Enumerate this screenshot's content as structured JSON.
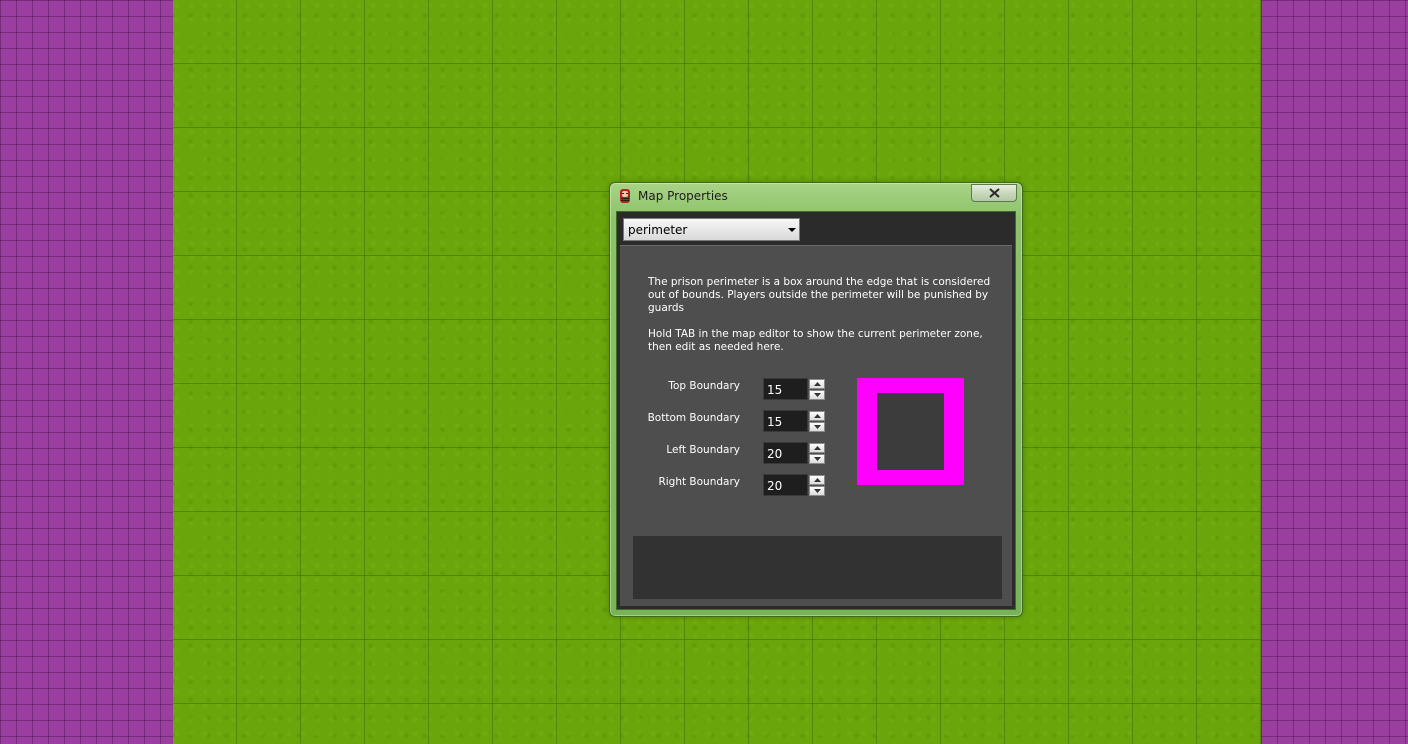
{
  "window": {
    "title": "Map Properties",
    "close_label": "✕"
  },
  "dropdown": {
    "selected": "perimeter"
  },
  "description": {
    "paragraph1": "The prison perimeter is a box around the edge that is considered out of bounds. Players outside the perimeter will be punished by guards",
    "paragraph2": "Hold TAB in the map editor to show the current perimeter zone, then edit as needed here."
  },
  "fields": {
    "top": {
      "label": "Top Boundary",
      "value": "15"
    },
    "bottom": {
      "label": "Bottom Boundary",
      "value": "15"
    },
    "left": {
      "label": "Left Boundary",
      "value": "20"
    },
    "right": {
      "label": "Right Boundary",
      "value": "20"
    }
  },
  "colors": {
    "perimeter_zone": "#ff00ff",
    "out_of_bounds": "#9a3fa0",
    "grass": "#6aa60b",
    "window_frame": "#8cc36a",
    "panel": "#4e4e4e"
  },
  "icons": {
    "app": "prisoner-icon",
    "close": "close-icon",
    "dropdown": "chevron-down-icon",
    "spin_up": "arrow-up-icon",
    "spin_down": "arrow-down-icon"
  }
}
